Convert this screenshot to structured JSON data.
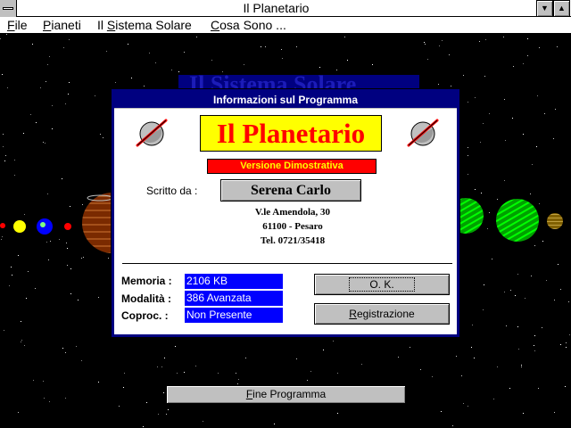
{
  "window": {
    "title": "Il Planetario",
    "minimize_glyph": "▼",
    "maximize_glyph": "▲"
  },
  "menu": [
    {
      "mnemonic": "F",
      "rest": "ile"
    },
    {
      "mnemonic": "P",
      "rest": "ianeti"
    },
    {
      "before": "Il ",
      "mnemonic": "S",
      "rest": "istema Solare"
    },
    {
      "mnemonic": "C",
      "rest": "osa Sono ..."
    }
  ],
  "background_title": "Il Sistema Solare",
  "dialog": {
    "caption": "Informazioni sul Programma",
    "logo_text": "Il Planetario",
    "version_text": "Versione Dimostrativa",
    "written_by_label": "Scritto da :",
    "author": "Serena Carlo",
    "address_lines": [
      "V.le Amendola, 30",
      "61100  -  Pesaro",
      "Tel.  0721/35418"
    ],
    "info": [
      {
        "label": "Memoria :",
        "value": "2106 KB"
      },
      {
        "label": "Modalità :",
        "value": "386 Avanzata"
      },
      {
        "label": "Coproc.  :",
        "value": "Non Presente"
      }
    ],
    "ok_label": "O. K.",
    "register_label": {
      "mnemonic": "R",
      "rest": "egistrazione"
    }
  },
  "end_button": {
    "mnemonic": "F",
    "rest": "ine Programma"
  },
  "icons": [
    "system-menu-icon",
    "minimize-icon",
    "maximize-icon",
    "planet-ring-icon"
  ],
  "colors": {
    "desktop_bg": "#000000",
    "dialog_caption": "#000080",
    "logo_bg": "#ffff00",
    "logo_text": "#ff0000",
    "version_bg": "#ff0000",
    "version_text": "#ffff00",
    "info_value_bg": "#0000ff",
    "button_face": "#c0c0c0"
  }
}
